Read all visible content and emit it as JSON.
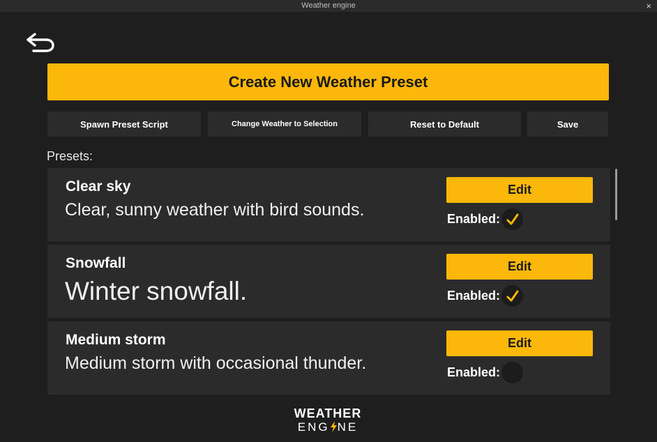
{
  "window": {
    "title": "Weather engine",
    "close_glyph": "×"
  },
  "header": {
    "back_icon": "undo-arrow-icon"
  },
  "create_button": {
    "label": "Create New Weather Preset"
  },
  "toolbar": {
    "spawn_label": "Spawn Preset Script",
    "change_label": "Change Weather to Selection",
    "reset_label": "Reset to Default",
    "save_label": "Save"
  },
  "presets_section": {
    "label": "Presets:"
  },
  "presets": [
    {
      "name": "Clear sky",
      "description": "Clear, sunny weather with bird sounds.",
      "edit_label": "Edit",
      "enabled_label": "Enabled:",
      "enabled": true
    },
    {
      "name": "Snowfall",
      "description": "Winter snowfall.",
      "edit_label": "Edit",
      "enabled_label": "Enabled:",
      "enabled": true
    },
    {
      "name": "Medium storm",
      "description": "Medium storm with occasional thunder.",
      "edit_label": "Edit",
      "enabled_label": "Enabled:",
      "enabled": false
    }
  ],
  "logo": {
    "line1": "WEATHER",
    "line2_part1": "ENG",
    "line2_part2": "NE",
    "bolt_icon": "lightning-bolt-icon"
  },
  "colors": {
    "accent": "#fbb80a",
    "background": "#1e1e1e",
    "card": "#2b2b2b"
  }
}
